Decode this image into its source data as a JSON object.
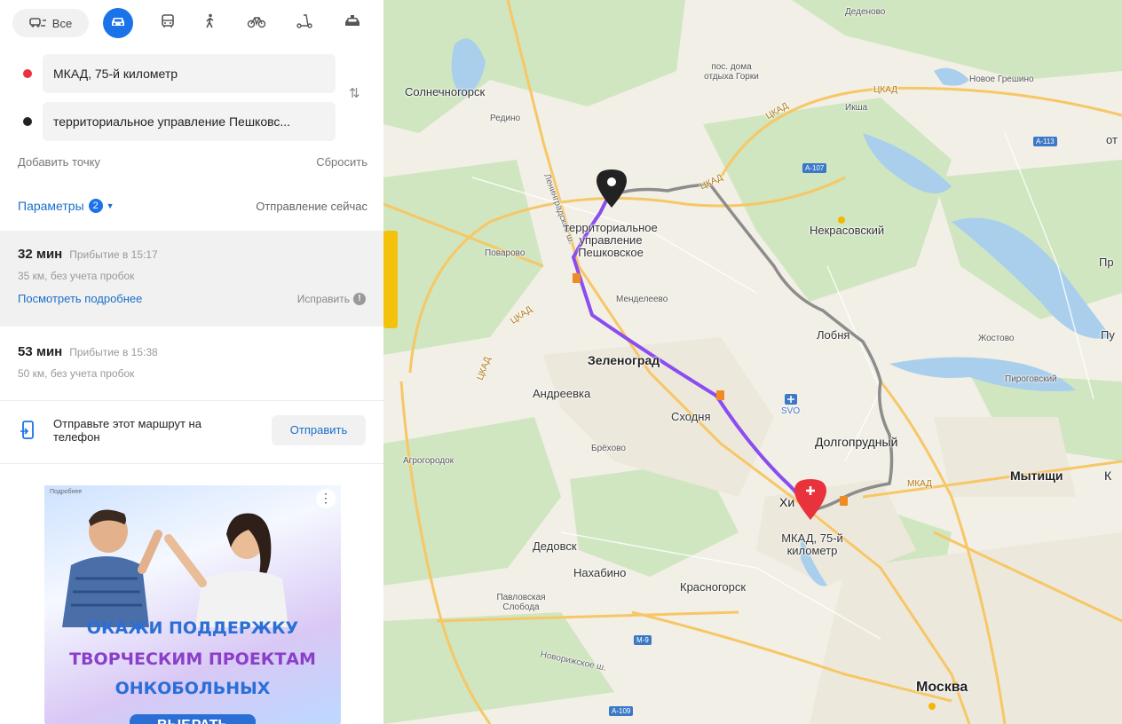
{
  "colors": {
    "accent": "#1a73e8",
    "link": "#1a6fc9",
    "route_main": "#8b4cf0",
    "route_alt": "#8c8c8c",
    "start_pin": "#e8323c",
    "end_pin": "#222222",
    "water": "#a9cfec",
    "forest": "#cfe6c0"
  },
  "sidebar": {
    "modes": [
      {
        "icon": "all-transport-icon",
        "label": "Все"
      },
      {
        "icon": "car-icon",
        "active": true
      },
      {
        "icon": "bus-icon"
      },
      {
        "icon": "pedestrian-icon"
      },
      {
        "icon": "bicycle-icon"
      },
      {
        "icon": "scooter-icon"
      },
      {
        "icon": "taxi-icon"
      }
    ],
    "from": "МКАД, 75-й километр",
    "to": "территориальное управление Пешковс...",
    "add_point": "Добавить точку",
    "reset": "Сбросить",
    "params_label": "Параметры",
    "params_count": "2",
    "departure": "Отправление сейчас",
    "routes": [
      {
        "time": "32 мин",
        "arrival": "Прибытие в 15:17",
        "details": "35 км, без учета пробок",
        "more": "Посмотреть подробнее",
        "fix": "Исправить"
      },
      {
        "time": "53 мин",
        "arrival": "Прибытие в 15:38",
        "details": "50 км, без учета пробок"
      }
    ],
    "send": {
      "text": "Отправьте этот маршрут на телефон",
      "button": "Отправить"
    },
    "ad": {
      "tag": "Подробнее",
      "line1": "ОКАЖИ ПОДДЕРЖКУ",
      "line2": "ТВОРЧЕСКИМ ПРОЕКТАМ",
      "line3": "ОНКОБОЛЬНЫХ",
      "button": "ВЫБРАТЬ"
    }
  },
  "map": {
    "places": {
      "top": "Деденово",
      "solnech": "Солнечногорск",
      "redino": "Редино",
      "posdoma": "пос. дома отдыха Горки",
      "novoe": "Новое Грешино",
      "iksha": "Икша",
      "nekras": "Некрасовский",
      "povarovo": "Поварово",
      "mend": "Менделеево",
      "lob": "Лобня",
      "zhost": "Жостово",
      "pirog": "Пироговский",
      "zel": "Зеленоград",
      "andr": "Андреевка",
      "shod": "Сходня",
      "dolg": "Долгопрудный",
      "bryk": "Брёхово",
      "agro": "Агрогородок",
      "myt": "Мытищи",
      "hi": "Хи",
      "ded": "Дедовск",
      "nah": "Нахабино",
      "kras": "Красногорск",
      "pavl": "Павловская Слобода",
      "mosk": "Москва",
      "svo": "SVO",
      "pr": "Пр",
      "pu": "Пу",
      "k": "К",
      "ot": "от"
    },
    "end_label": "территориальное управление Пешковское",
    "start_label": "МКАД, 75-й километр",
    "highways": [
      "A-107",
      "A-113",
      "M-9",
      "A-109"
    ],
    "road_names": {
      "ckad": "ЦКАД",
      "mkad": "МКАД",
      "lening": "Ленинградское ш.",
      "novo": "Новорижское ш."
    }
  }
}
